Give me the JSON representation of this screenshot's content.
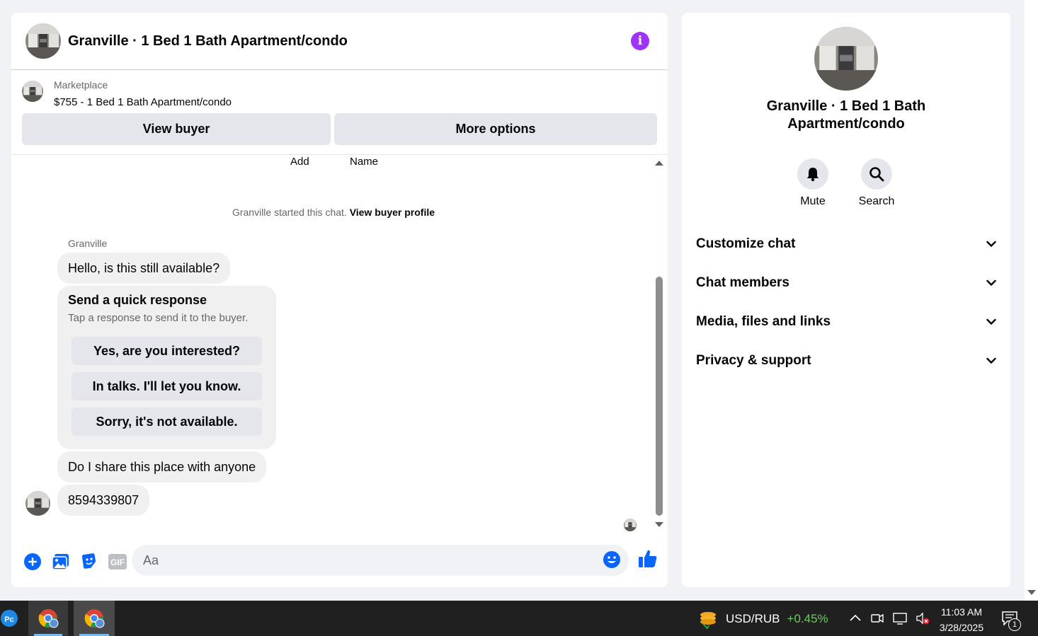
{
  "chat": {
    "title": "Granville · 1 Bed 1 Bath Apartment/condo",
    "listing": {
      "source": "Marketplace",
      "price_title": "$755 - 1 Bed 1 Bath Apartment/condo",
      "view_buyer": "View buyer",
      "more_options": "More options"
    },
    "top_labels": [
      "Add",
      "Name"
    ],
    "system": {
      "text": "Granville started this chat.",
      "link": "View buyer profile"
    },
    "sender": "Granville",
    "messages": {
      "m1": "Hello, is this still available?",
      "m2": "Do I share this place with anyone",
      "m3": "8594339807"
    },
    "quick_response": {
      "title": "Send a quick response",
      "subtitle": "Tap a response to send it to the buyer.",
      "options": [
        "Yes, are you interested?",
        "In talks. I'll let you know.",
        "Sorry, it's not available."
      ]
    },
    "composer": {
      "placeholder": "Aa",
      "gif_label": "GIF"
    }
  },
  "info": {
    "title": "Granville · 1 Bed 1 Bath Apartment/condo",
    "actions": {
      "mute": "Mute",
      "search": "Search"
    },
    "sections": [
      "Customize chat",
      "Chat members",
      "Media, files and links",
      "Privacy & support"
    ]
  },
  "taskbar": {
    "ticker_pair": "USD/RUB",
    "ticker_change": "+0.45%",
    "time": "11:03 AM",
    "date": "3/28/2025",
    "notification_count": "1"
  },
  "colors": {
    "accent": "#0866ff",
    "info_icon": "#a033ff",
    "bubble": "#f0f0f0",
    "ticker_up": "#6ccb5f"
  }
}
